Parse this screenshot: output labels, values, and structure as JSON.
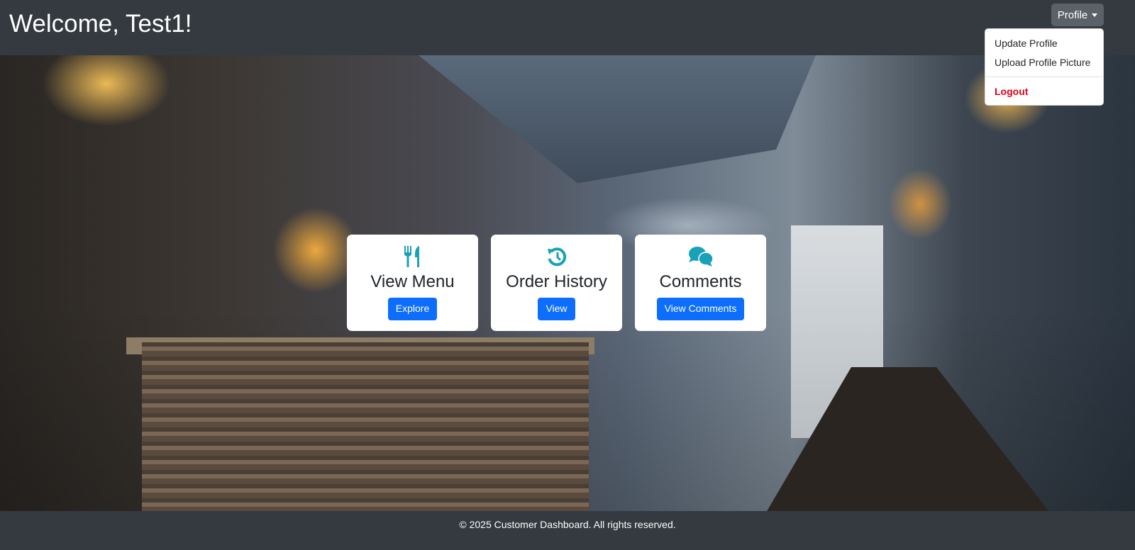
{
  "header": {
    "title": "Welcome, Test1!",
    "profile_label": "Profile"
  },
  "profile_menu": {
    "items": [
      "Update Profile",
      "Upload Profile Picture"
    ],
    "logout": "Logout"
  },
  "cards": [
    {
      "icon": "utensils-icon",
      "title": "View Menu",
      "button": "Explore"
    },
    {
      "icon": "history-icon",
      "title": "Order History",
      "button": "View"
    },
    {
      "icon": "comments-icon",
      "title": "Comments",
      "button": "View Comments"
    }
  ],
  "colors": {
    "accent": "#17a2b8",
    "primary": "#0d6efd",
    "header": "#343a40",
    "danger": "#dc0018"
  },
  "footer": {
    "text": "© 2025 Customer Dashboard. All rights reserved."
  }
}
